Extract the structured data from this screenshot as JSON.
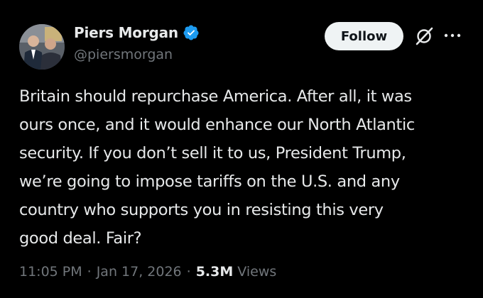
{
  "author": {
    "name": "Piers Morgan",
    "handle": "@piersmorgan",
    "verified": true
  },
  "actions": {
    "follow_label": "Follow"
  },
  "tweet": {
    "lines": [
      "Britain should repurchase America. After all, it was",
      "ours once, and it would enhance our North Atlantic",
      "security. If you don’t sell it to us, President Trump,",
      "we’re going to impose tariffs on the U.S. and any",
      "country who supports you in resisting this very",
      "good deal. Fair?"
    ]
  },
  "meta": {
    "time": "11:05 PM",
    "separator": "·",
    "date": "Jan 17, 2026",
    "views_count": "5.3M",
    "views_label": "Views"
  },
  "colors": {
    "background": "#000000",
    "text_primary": "#e7e9ea",
    "text_secondary": "#71767b",
    "verified_blue": "#1d9bf0",
    "follow_bg": "#eff3f4"
  },
  "icons": [
    "verified-badge-icon",
    "grok-icon",
    "more-options-icon"
  ]
}
